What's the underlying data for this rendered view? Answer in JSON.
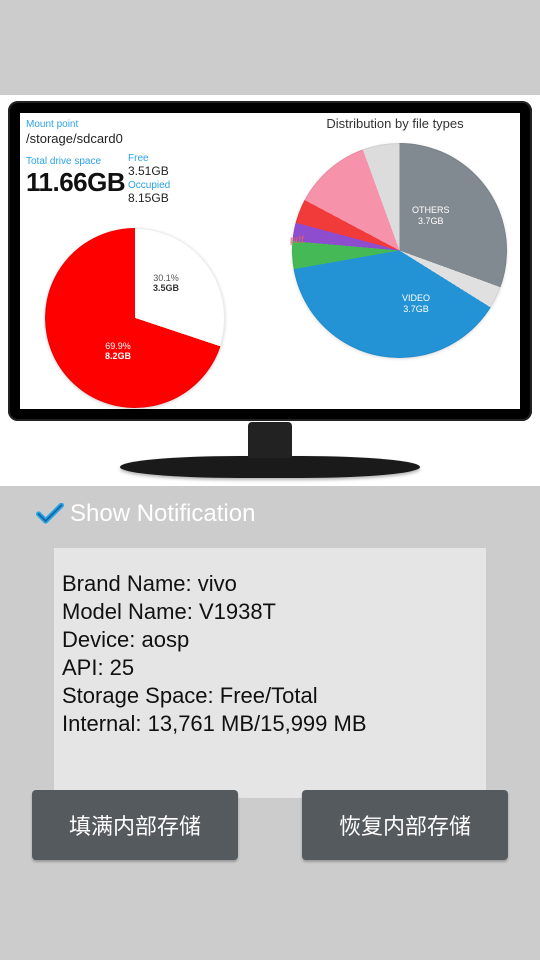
{
  "monitor": {
    "mount_label": "Mount point",
    "mount_path": "/storage/sdcard0",
    "total_label": "Total drive space",
    "total_value": "11.66GB",
    "free_label": "Free",
    "free_value": "3.51GB",
    "occupied_label": "Occupied",
    "occupied_value": "8.15GB",
    "dist_title": "Distribution by file types"
  },
  "chart_data": [
    {
      "type": "pie",
      "title": "Total drive space",
      "slices": [
        {
          "name": "Free",
          "percent": 30.1,
          "size": "3.5GB",
          "color": "#ffffff",
          "label_color": "dark"
        },
        {
          "name": "Occupied",
          "percent": 69.9,
          "size": "8.2GB",
          "color": "#ff0000",
          "label_color": "light"
        }
      ]
    },
    {
      "type": "pie",
      "title": "Distribution by file types",
      "slices": [
        {
          "name": "OTHERS",
          "size": "3.7GB",
          "approx_deg": 110,
          "color": "#808a90"
        },
        {
          "name": "",
          "size": "",
          "approx_deg": 12,
          "color": "#e0e0e0"
        },
        {
          "name": "VIDEO",
          "size": "3.7GB",
          "approx_deg": 138,
          "color": "#2393d6"
        },
        {
          "name": "",
          "size": "",
          "approx_deg": 15,
          "color": "#44b956"
        },
        {
          "name": "",
          "size": "",
          "approx_deg": 10,
          "color": "#8e4dcf"
        },
        {
          "name": "",
          "size": "",
          "approx_deg": 13,
          "color": "#f13a3a"
        },
        {
          "name": "pdf",
          "size": "",
          "approx_deg": 42,
          "color": "#f792ab"
        },
        {
          "name": "",
          "size": "",
          "approx_deg": 20,
          "color": "#dcdcdc"
        }
      ]
    }
  ],
  "checkbox": {
    "label": "Show Notification",
    "checked": true
  },
  "info": {
    "brand": "Brand Name: vivo",
    "model": "Model Name: V1938T",
    "device": "Device: aosp",
    "api": "API: 25",
    "storage": "Storage Space: Free/Total",
    "internal": "Internal: 13,761 MB/15,999 MB"
  },
  "buttons": {
    "fill": "填满内部存储",
    "restore": "恢复内部存储"
  }
}
